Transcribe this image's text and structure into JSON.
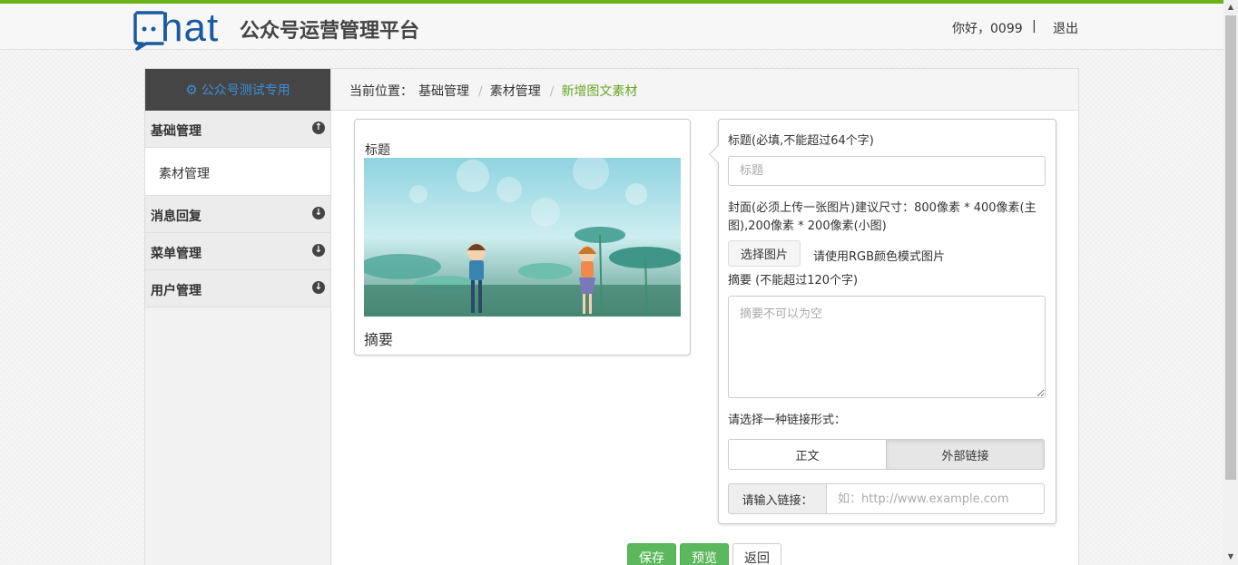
{
  "header": {
    "logo_text": "hat",
    "site_title": "公众号运营管理平台",
    "greeting": "你好，0099",
    "separator": "|",
    "logout": "退出"
  },
  "sidebar": {
    "account": "公众号测试专用",
    "groups": [
      {
        "label": "基础管理",
        "expanded": true,
        "items": [
          "素材管理"
        ]
      },
      {
        "label": "消息回复",
        "expanded": false
      },
      {
        "label": "菜单管理",
        "expanded": false
      },
      {
        "label": "用户管理",
        "expanded": false
      }
    ]
  },
  "breadcrumb": {
    "prefix": "当前位置：",
    "items": [
      "基础管理",
      "素材管理",
      "新增图文素材"
    ]
  },
  "preview": {
    "title": "标题",
    "summary": "摘要"
  },
  "form": {
    "title_label": "标题(必填,不能超过64个字)",
    "title_placeholder": "标题",
    "cover_label": "封面(必须上传一张图片)建议尺寸：800像素 * 400像素(主图),200像素 * 200像素(小图)",
    "pick_button": "选择图片",
    "pick_hint": "请使用RGB颜色模式图片",
    "summary_label": "摘要 (不能超过120个字)",
    "summary_placeholder": "摘要不可以为空",
    "link_type_label": "请选择一种链接形式：",
    "link_types": [
      "正文",
      "外部链接"
    ],
    "selected_link_type": "外部链接",
    "link_addon": "请输入链接：",
    "link_placeholder": "如：http://www.example.com"
  },
  "actions": {
    "save": "保存",
    "preview": "预览",
    "back": "返回"
  },
  "colors": {
    "accent_green": "#6cb31a",
    "brand_blue": "#1a5a9e",
    "button_green": "#5cb85c"
  }
}
